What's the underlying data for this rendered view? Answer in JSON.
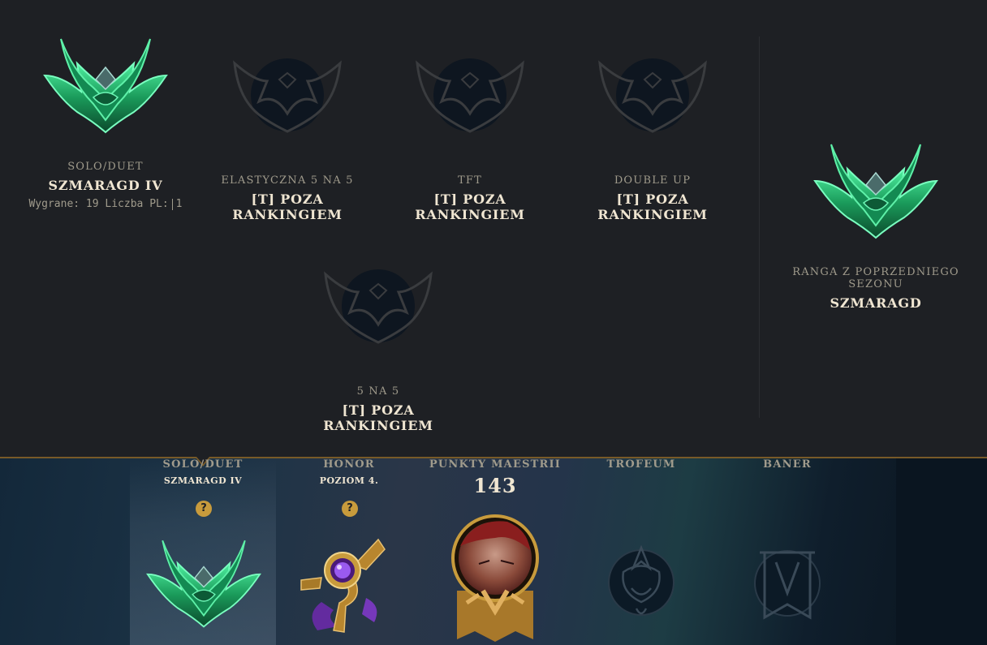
{
  "queues": [
    {
      "name": "SOLO/DUET",
      "rank": "SZMARAGD IV",
      "stats_label": "Wygrane: 19 Liczba PL:",
      "stats_value": "1",
      "emblem": "emerald-emblem"
    },
    {
      "name": "ELASTYCZNA 5 NA 5",
      "rank": "[T] POZA RANKINGIEM",
      "emblem": "unranked-emblem"
    },
    {
      "name": "TFT",
      "rank": "[T] POZA RANKINGIEM",
      "emblem": "unranked-emblem"
    },
    {
      "name": "DOUBLE UP",
      "rank": "[T] POZA RANKINGIEM",
      "emblem": "unranked-emblem"
    },
    {
      "name": "5 NA 5",
      "rank": "[T] POZA RANKINGIEM",
      "emblem": "unranked-emblem"
    }
  ],
  "previous_season": {
    "label": "RANGA Z POPRZEDNIEGO SEZONU",
    "rank": "SZMARAGD",
    "emblem": "emerald-emblem"
  },
  "bottom": {
    "solo": {
      "label": "SOLO/DUET",
      "sub": "SZMARAGD IV",
      "help": "?"
    },
    "honor": {
      "label": "HONOR",
      "sub": "POZIOM 4.",
      "help": "?"
    },
    "mastery": {
      "label": "PUNKTY MAESTRII",
      "value": "143"
    },
    "trophy": {
      "label": "TROFEUM"
    },
    "banner": {
      "label": "BANER"
    }
  },
  "colors": {
    "accent_gold": "#c89b3c",
    "border_gold": "#785a28",
    "emerald": "#1fae6b",
    "text_light": "#f0e6d2",
    "text_muted": "#a09b8c"
  }
}
